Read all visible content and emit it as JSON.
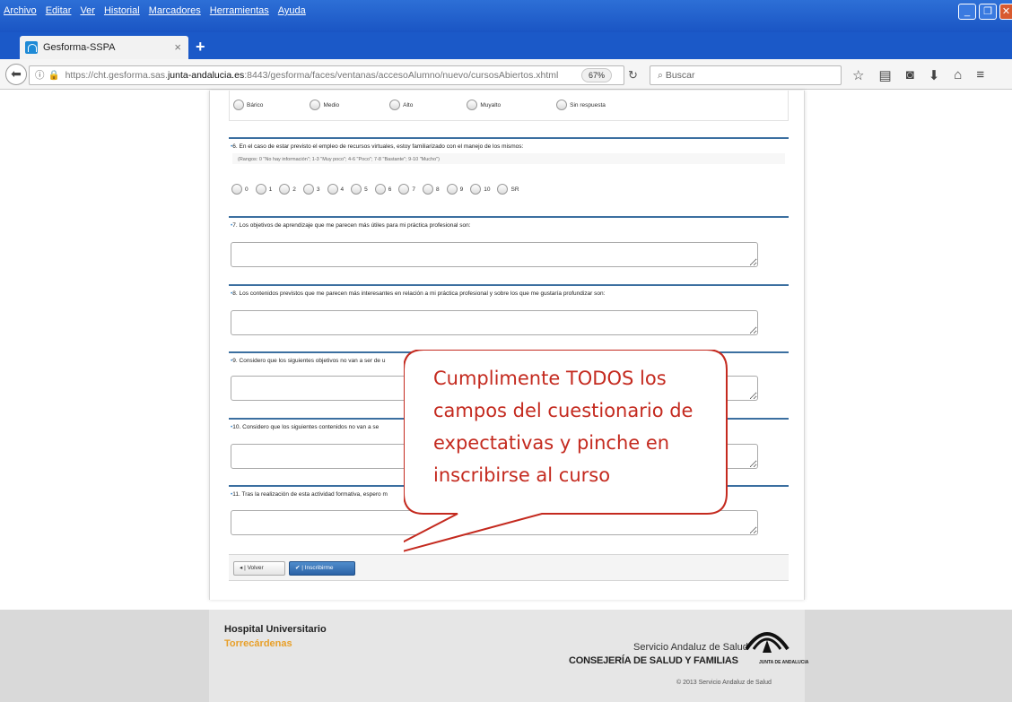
{
  "browser": {
    "menu": [
      "Archivo",
      "Editar",
      "Ver",
      "Historial",
      "Marcadores",
      "Herramientas",
      "Ayuda"
    ],
    "tab_title": "Gesforma-SSPA",
    "url_prefix": "https://cht.gesforma.sas.",
    "url_domain": "junta-andalucia.es",
    "url_suffix": ":8443/gesforma/faces/ventanas/accesoAlumno/nuevo/cursosAbiertos.xhtml",
    "zoom": "67%",
    "search_placeholder": "Buscar"
  },
  "form": {
    "level_options": [
      "Bárico",
      "Medio",
      "Alto",
      "Muyalto",
      "Sin respuesta"
    ],
    "q6": {
      "title": "6. En el caso de estar previsto el empleo de recursos virtuales, estoy familiarizado con el manejo de los mismos:",
      "hint": "(Rangos: 0 \"No hay información\"; 1-3 \"Muy poco\"; 4-6 \"Poco\"; 7-8 \"Bastante\"; 9-10 \"Mucho\")",
      "options": [
        "0",
        "1",
        "2",
        "3",
        "4",
        "5",
        "6",
        "7",
        "8",
        "9",
        "10",
        "SR"
      ]
    },
    "q7": {
      "title": "7. Los objetivos de aprendizaje que me parecen más útiles para mi práctica profesional son:"
    },
    "q8": {
      "title": "8. Los contenidos previstos que me parecen más interesantes en relación a mi práctica profesional y sobre los que me gustaría profundizar son:"
    },
    "q9": {
      "title": "9. Considero que los siguientes objetivos no van a ser de u"
    },
    "q10": {
      "title": "10. Considero que los siguientes contenidos no van a se"
    },
    "q11": {
      "title": "11. Tras la realización de esta actividad formativa, espero m"
    },
    "btn_back": "Volver",
    "btn_enroll": "Inscribirme"
  },
  "callout": {
    "text": "Cumplimente TODOS los campos del cuestionario de expectativas y pinche en inscribirse al curso"
  },
  "footer": {
    "hospital_line1": "Hospital Universitario",
    "hospital_line2": "Torrecárdenas",
    "sas": "Servicio Andaluz de Salud",
    "consejeria": "CONSEJERÍA DE SALUD Y FAMILIAS",
    "junta": "JUNTA DE ANDALUCIA",
    "copyright": "© 2013 Servicio Andaluz de Salud"
  }
}
